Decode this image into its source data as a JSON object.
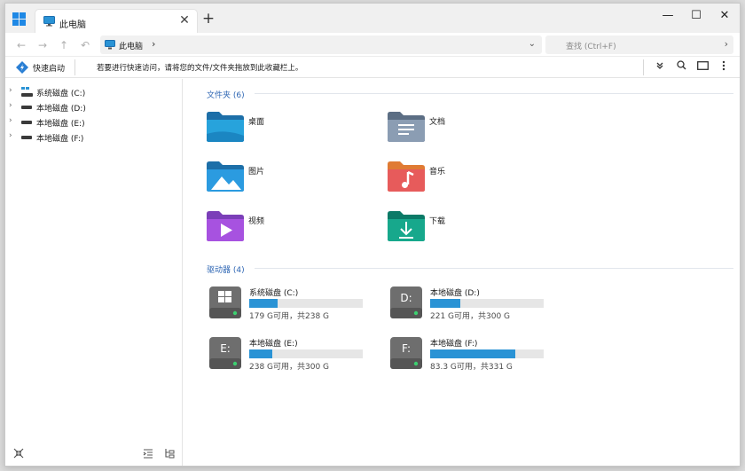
{
  "colors": {
    "accent": "#2a93d5",
    "section": "#2f67b4",
    "bar_track": "#e6e6e6"
  },
  "titlebar": {
    "tab_label": "此电脑",
    "tab_close": "✕",
    "new_tab": "+",
    "minimize": "—",
    "maximize": "☐",
    "close": "✕"
  },
  "address": {
    "back": "←",
    "forward": "→",
    "up": "↑",
    "undo": "↶",
    "path_label": "此电脑",
    "path_sep": "›",
    "dropdown": "⌄",
    "search_placeholder": "查找 (Ctrl+F)",
    "search_go": "›"
  },
  "quickbar": {
    "quick_launch": "快速启动",
    "hint": "若要进行快速访问，请将您的文件/文件夹拖放到此收藏栏上。",
    "icons": [
      "chevrons-down-icon",
      "search-icon",
      "panel-icon",
      "more-icon"
    ]
  },
  "sidebar": {
    "items": [
      {
        "label": "系统磁盘 (C:)"
      },
      {
        "label": "本地磁盘 (D:)"
      },
      {
        "label": "本地磁盘 (E:)"
      },
      {
        "label": "本地磁盘 (F:)"
      }
    ],
    "arrow": "›"
  },
  "folders_section": {
    "title": "文件夹 (6)"
  },
  "folders": [
    {
      "label": "桌面",
      "icon": "desktop-folder-icon"
    },
    {
      "label": "文档",
      "icon": "documents-folder-icon"
    },
    {
      "label": "图片",
      "icon": "pictures-folder-icon"
    },
    {
      "label": "音乐",
      "icon": "music-folder-icon"
    },
    {
      "label": "视频",
      "icon": "videos-folder-icon"
    },
    {
      "label": "下载",
      "icon": "downloads-folder-icon"
    }
  ],
  "drives_section": {
    "title": "驱动器 (4)"
  },
  "drives": [
    {
      "name": "系统磁盘 (C:)",
      "letter": "",
      "info": "179 G可用，共238 G",
      "used_fraction": 0.248
    },
    {
      "name": "本地磁盘 (D:)",
      "letter": "D:",
      "info": "221 G可用，共300 G",
      "used_fraction": 0.263
    },
    {
      "name": "本地磁盘 (E:)",
      "letter": "E:",
      "info": "238 G可用，共300 G",
      "used_fraction": 0.207
    },
    {
      "name": "本地磁盘 (F:)",
      "letter": "F:",
      "info": "83.3 G可用，共331 G",
      "used_fraction": 0.748
    }
  ]
}
